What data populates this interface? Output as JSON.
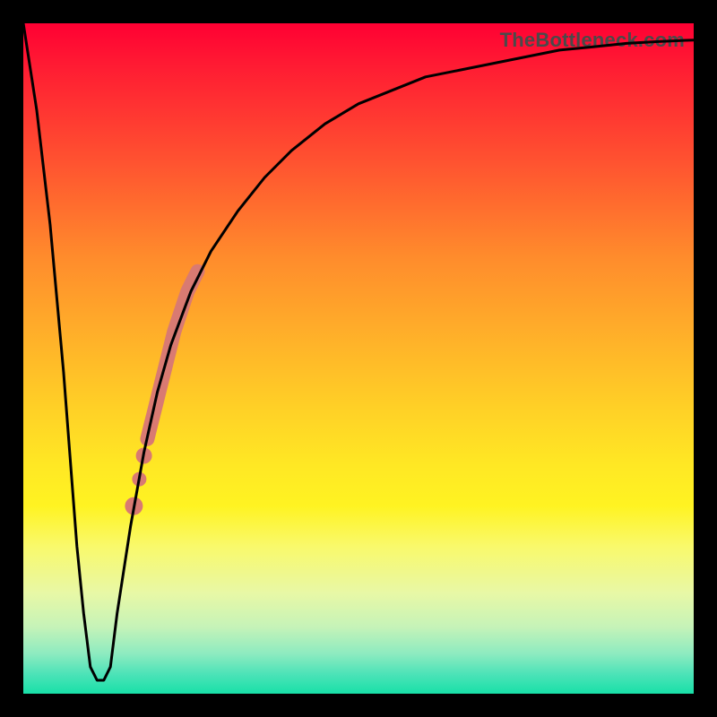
{
  "attribution": "TheBottleneck.com",
  "chart_data": {
    "type": "line",
    "title": "",
    "xlabel": "",
    "ylabel": "",
    "xlim": [
      0,
      100
    ],
    "ylim": [
      0,
      100
    ],
    "grid": false,
    "legend": false,
    "background": "rainbow-gradient-vertical",
    "series": [
      {
        "name": "bottleneck-curve",
        "x": [
          0,
          2,
          4,
          6,
          8,
          9,
          10,
          11,
          12,
          13,
          14,
          16,
          18,
          20,
          22,
          25,
          28,
          32,
          36,
          40,
          45,
          50,
          55,
          60,
          65,
          70,
          75,
          80,
          85,
          90,
          95,
          100
        ],
        "y": [
          100,
          87,
          70,
          48,
          22,
          12,
          4,
          2,
          2,
          4,
          12,
          25,
          36,
          45,
          52,
          60,
          66,
          72,
          77,
          81,
          85,
          88,
          90,
          92,
          93,
          94,
          95,
          96,
          96.5,
          97,
          97.3,
          97.5
        ],
        "color": "#000000",
        "linewidth": 3
      }
    ],
    "annotations": [
      {
        "name": "highlight-segment",
        "type": "line-highlight",
        "x": [
          18.5,
          19.0,
          19.5,
          20.0,
          20.5,
          21.0,
          21.5,
          22.0,
          22.5,
          23.0,
          23.5,
          24.0,
          24.5,
          25.0,
          25.5,
          26.0
        ],
        "y": [
          38.0,
          40.0,
          42.0,
          44.0,
          46.0,
          48.0,
          50.0,
          52.0,
          54.0,
          55.5,
          57.0,
          58.5,
          60.0,
          61.0,
          62.0,
          63.0
        ],
        "color": "#d97a72",
        "linewidth": 16
      },
      {
        "name": "highlight-dot-1",
        "type": "point",
        "x": 18.0,
        "y": 35.5,
        "color": "#d97a72",
        "radius": 9
      },
      {
        "name": "highlight-dot-2",
        "type": "point",
        "x": 17.3,
        "y": 32.0,
        "color": "#d97a72",
        "radius": 8
      },
      {
        "name": "highlight-dot-3",
        "type": "point",
        "x": 16.5,
        "y": 28.0,
        "color": "#d97a72",
        "radius": 10
      }
    ]
  }
}
